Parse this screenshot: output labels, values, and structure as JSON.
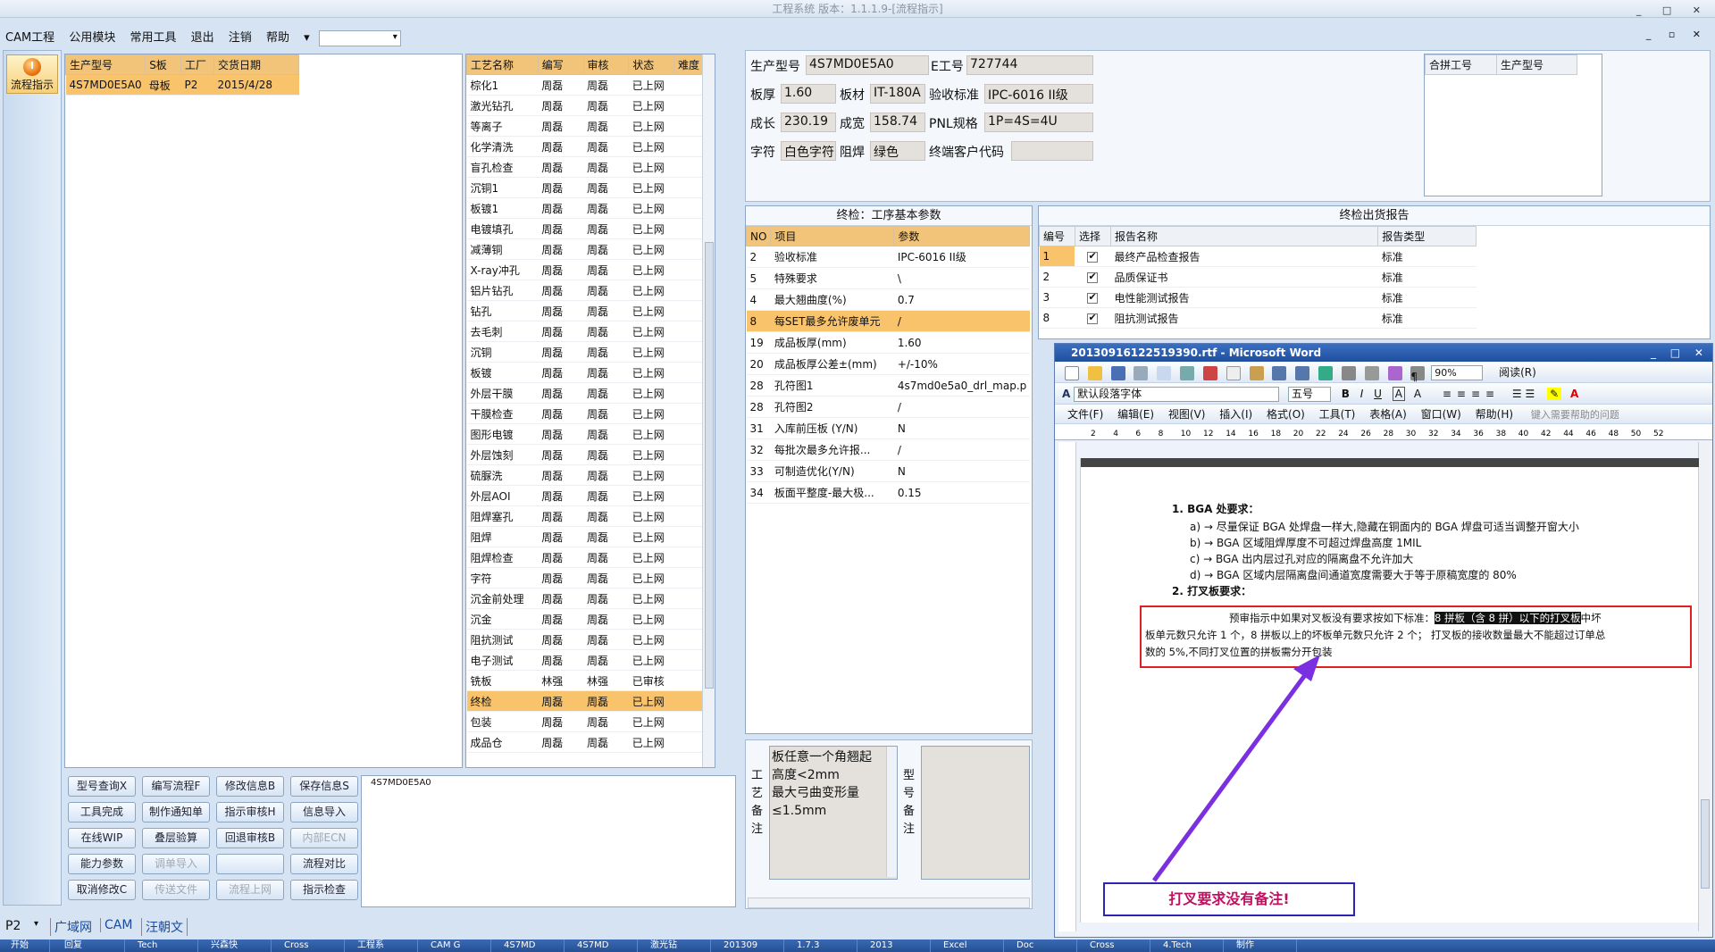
{
  "window": {
    "title": "工程系统 版本：1.1.1.9-[流程指示]"
  },
  "menu": [
    "CAM工程",
    "公用模块",
    "常用工具",
    "退出",
    "注销",
    "帮助"
  ],
  "nav": {
    "flow_button": "流程指示"
  },
  "product_grid": {
    "headers": [
      "生产型号",
      "S板",
      "工厂",
      "交货日期"
    ],
    "rows": [
      [
        "4S7MD0E5A0",
        "母板",
        "P2",
        "2015/4/28"
      ]
    ]
  },
  "process_grid": {
    "headers": [
      "工艺名称",
      "编写",
      "审核",
      "状态",
      "难度"
    ],
    "rows": [
      [
        "棕化1",
        "周磊",
        "周磊",
        "已上网"
      ],
      [
        "激光钻孔",
        "周磊",
        "周磊",
        "已上网"
      ],
      [
        "等离子",
        "周磊",
        "周磊",
        "已上网"
      ],
      [
        "化学清洗",
        "周磊",
        "周磊",
        "已上网"
      ],
      [
        "盲孔检查",
        "周磊",
        "周磊",
        "已上网"
      ],
      [
        "沉铜1",
        "周磊",
        "周磊",
        "已上网"
      ],
      [
        "板镀1",
        "周磊",
        "周磊",
        "已上网"
      ],
      [
        "电镀填孔",
        "周磊",
        "周磊",
        "已上网"
      ],
      [
        "减薄铜",
        "周磊",
        "周磊",
        "已上网"
      ],
      [
        "X-ray冲孔",
        "周磊",
        "周磊",
        "已上网"
      ],
      [
        "铝片钻孔",
        "周磊",
        "周磊",
        "已上网"
      ],
      [
        "钻孔",
        "周磊",
        "周磊",
        "已上网"
      ],
      [
        "去毛刺",
        "周磊",
        "周磊",
        "已上网"
      ],
      [
        "沉铜",
        "周磊",
        "周磊",
        "已上网"
      ],
      [
        "板镀",
        "周磊",
        "周磊",
        "已上网"
      ],
      [
        "外层干膜",
        "周磊",
        "周磊",
        "已上网"
      ],
      [
        "干膜检查",
        "周磊",
        "周磊",
        "已上网"
      ],
      [
        "图形电镀",
        "周磊",
        "周磊",
        "已上网"
      ],
      [
        "外层蚀刻",
        "周磊",
        "周磊",
        "已上网"
      ],
      [
        "硫脲洗",
        "周磊",
        "周磊",
        "已上网"
      ],
      [
        "外层AOI",
        "周磊",
        "周磊",
        "已上网"
      ],
      [
        "阻焊塞孔",
        "周磊",
        "周磊",
        "已上网"
      ],
      [
        "阻焊",
        "周磊",
        "周磊",
        "已上网"
      ],
      [
        "阻焊检查",
        "周磊",
        "周磊",
        "已上网"
      ],
      [
        "字符",
        "周磊",
        "周磊",
        "已上网"
      ],
      [
        "沉金前处理",
        "周磊",
        "周磊",
        "已上网"
      ],
      [
        "沉金",
        "周磊",
        "周磊",
        "已上网"
      ],
      [
        "阻抗测试",
        "周磊",
        "周磊",
        "已上网"
      ],
      [
        "电子测试",
        "周磊",
        "周磊",
        "已上网"
      ],
      [
        "铣板",
        "林强",
        "林强",
        "已审核"
      ],
      [
        "终检",
        "周磊",
        "周磊",
        "已上网"
      ],
      [
        "包装",
        "周磊",
        "周磊",
        "已上网"
      ],
      [
        "成品仓",
        "周磊",
        "周磊",
        "已上网"
      ]
    ],
    "selected_index": 30
  },
  "buttons": [
    [
      "型号查询X",
      "编写流程F",
      "修改信息B",
      "保存信息S"
    ],
    [
      "工具完成",
      "制作通知单",
      "指示审核H",
      "信息导入"
    ],
    [
      "在线WIP",
      "叠层验算",
      "回退审核B",
      "内部ECN"
    ],
    [
      "能力参数",
      "调单导入",
      "",
      "流程对比"
    ],
    [
      "取消修改C",
      "传送文件",
      "流程上网",
      "指示检查"
    ]
  ],
  "disabled_buttons": [
    "内部ECN",
    "调单导入",
    "传送文件",
    "流程上网"
  ],
  "notes": {
    "text": "4S7MD0E5A0"
  },
  "info": {
    "model_label": "生产型号",
    "model": "4S7MD0E5A0",
    "e_label": "E工号",
    "e_no": "727744",
    "thick_label": "板厚",
    "thick": "1.60",
    "mat_label": "板材",
    "mat": "IT-180A",
    "std_label": "验收标准",
    "std": "IPC-6016 II级",
    "len_label": "成长",
    "len": "230.19",
    "wid_label": "成宽",
    "wid": "158.74",
    "pnl_label": "PNL规格",
    "pnl": "1P=4S=4U",
    "char_label": "字符",
    "char": "白色字符",
    "mask_label": "阻焊",
    "mask": "绿色",
    "cust_label": "终端客户代码",
    "cust": ""
  },
  "merge": {
    "headers": [
      "合拼工号",
      "生产型号"
    ]
  },
  "params": {
    "title": "终检：工序基本参数",
    "headers": [
      "NO",
      "项目",
      "参数"
    ],
    "rows": [
      [
        "2",
        "验收标准",
        "IPC-6016 II级"
      ],
      [
        "5",
        "特殊要求",
        "\\"
      ],
      [
        "4",
        "最大翘曲度(%)",
        "0.7"
      ],
      [
        "8",
        "每SET最多允许废单元",
        "/"
      ],
      [
        "19",
        "成品板厚(mm)",
        "1.60"
      ],
      [
        "20",
        "成品板厚公差±(mm)",
        "+/-10%"
      ],
      [
        "28",
        "孔符图1",
        "4s7md0e5a0_drl_map.p"
      ],
      [
        "28",
        "孔符图2",
        "/"
      ],
      [
        "31",
        "入库前压板 (Y/N)",
        "N"
      ],
      [
        "32",
        "每批次最多允许报...",
        "/"
      ],
      [
        "33",
        "可制造优化(Y/N)",
        "N"
      ],
      [
        "34",
        "板面平整度-最大极...",
        "0.15"
      ]
    ],
    "selected_index": 3
  },
  "reports": {
    "title": "终检出货报告",
    "headers": [
      "编号",
      "选择",
      "报告名称",
      "报告类型"
    ],
    "rows": [
      [
        "1",
        "最终产品检查报告",
        "标准"
      ],
      [
        "2",
        "品质保证书",
        "标准"
      ],
      [
        "3",
        "电性能测试报告",
        "标准"
      ],
      [
        "8",
        "阻抗测试报告",
        "标准"
      ]
    ]
  },
  "remarks": {
    "craft_label": "工艺备注",
    "craft_lines": [
      "板任意一个角翘起",
      "高度<2mm",
      "最大弓曲变形量",
      "≤1.5mm"
    ],
    "model_label": "型号备注"
  },
  "word": {
    "title": "20130916122519390.rtf - Microsoft Word",
    "zoom": "90%",
    "read_btn": "阅读(R)",
    "style": "默认段落字体",
    "size": "五号",
    "menus": [
      "文件(F)",
      "编辑(E)",
      "视图(V)",
      "插入(I)",
      "格式(O)",
      "工具(T)",
      "表格(A)",
      "窗口(W)",
      "帮助(H)"
    ],
    "help_placeholder": "键入需要帮助的问题",
    "doc": {
      "h1": "1. BGA 处要求：",
      "a": "a) → 尽量保证 BGA 处焊盘一样大,隐藏在铜面内的 BGA 焊盘可适当调整开窗大小",
      "b": "b) → BGA 区域阻焊厚度不可超过焊盘高度 1MIL",
      "c": "c) → BGA 出内层过孔对应的隔离盘不允许加大",
      "d": "d) → BGA 区域内层隔离盘间通道宽度需要大于等于原稿宽度的 80%",
      "h2": "2. 打叉板要求：",
      "p1a": "预审指示中如果对叉板没有要求按如下标准：",
      "p1b": "8 拼板（含 8 拼）以下的打叉板",
      "p1c": "中坏",
      "p2": "板单元数只允许 1 个，8 拼板以上的坏板单元数只允许 2 个；  打叉板的接收数量最大不能超过订单总",
      "p3": "数的 5%,不同打叉位置的拼板需分开包装"
    },
    "annotation": "打叉要求没有备注!"
  },
  "status": {
    "factory": "P2",
    "tabs": [
      "广域网",
      "CAM",
      "汪朝文"
    ]
  },
  "taskbar": [
    "开始",
    "回复",
    "Tech",
    "兴森快",
    "Cross",
    "工程系",
    "CAM G",
    "4S7MD",
    "4S7MD",
    "激光钻",
    "201309",
    "1.7.3",
    "2013",
    "Excel",
    "Doc",
    "Cross",
    "4.Tech",
    "制作"
  ],
  "colors": {
    "header": "#f1c47a",
    "selected": "#f8c36b",
    "annotation_box": "#e02020",
    "arrow": "#7a2fe0",
    "note_border": "#2b24b6"
  }
}
